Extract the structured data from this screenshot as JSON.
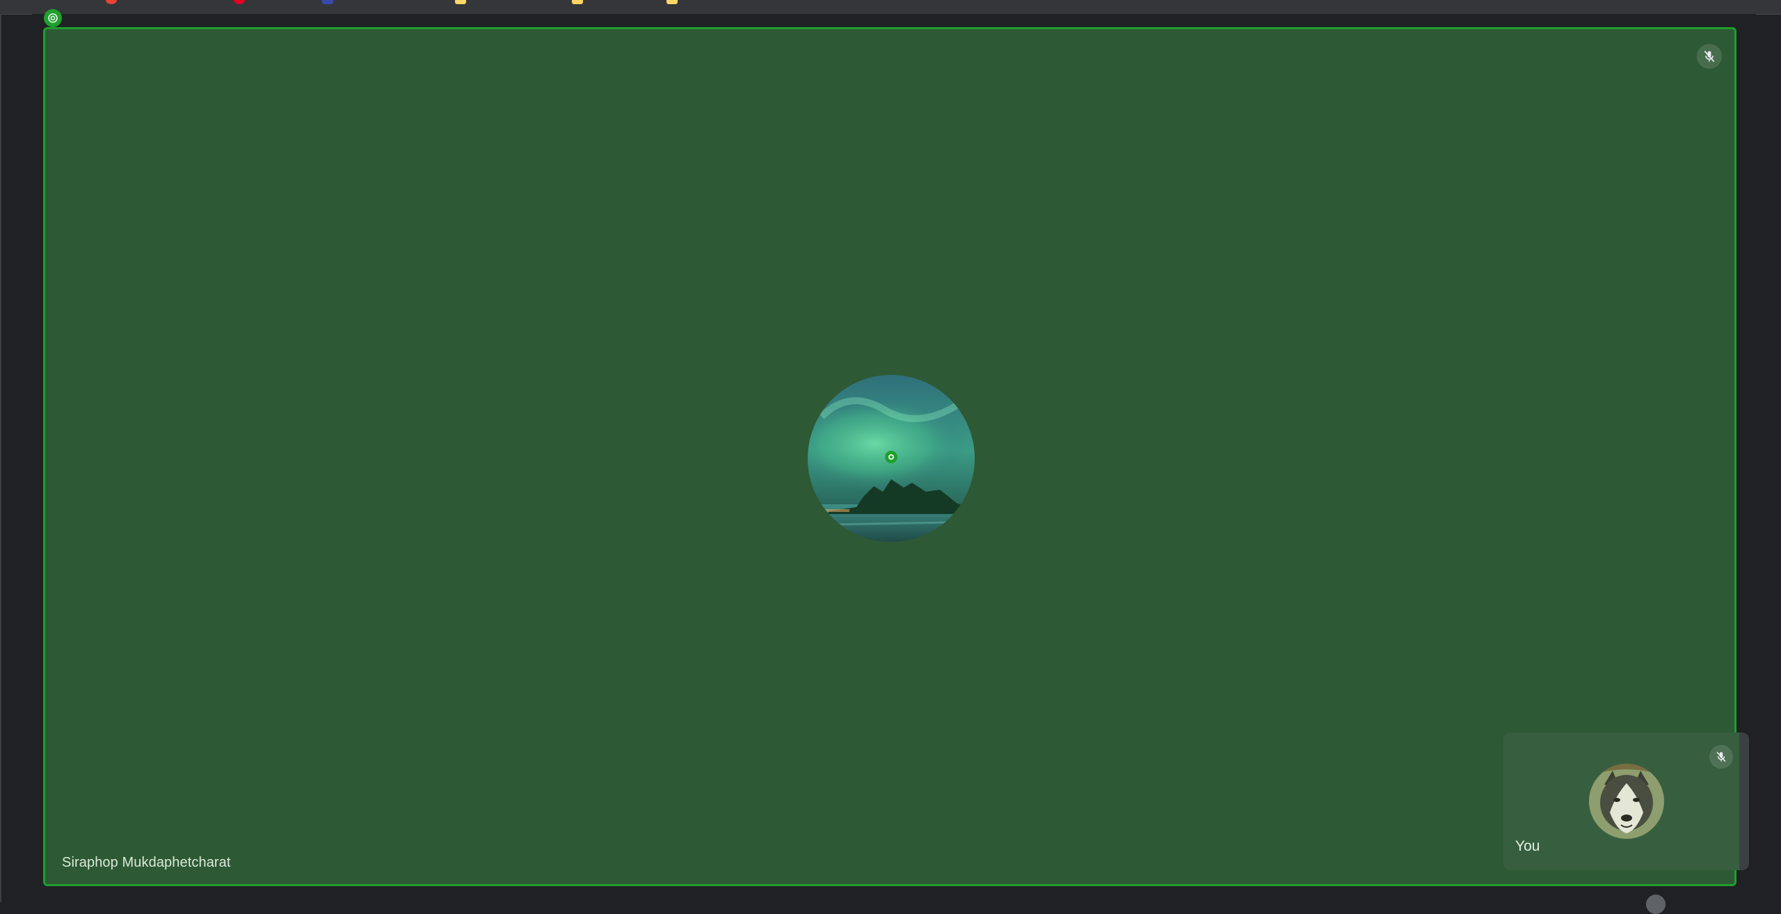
{
  "bookmarks_bar": {
    "icons": [
      {
        "name": "bookmark-red-circle-icon",
        "color": "#ea4335"
      },
      {
        "name": "bookmark-pinterest-icon",
        "color": "#e60023"
      },
      {
        "name": "bookmark-blue-icon",
        "color": "#3949ab"
      },
      {
        "name": "bookmark-folder-icon",
        "color": "#fdd663"
      },
      {
        "name": "bookmark-folder-icon",
        "color": "#fdd663"
      },
      {
        "name": "bookmark-folder-icon",
        "color": "#fdd663"
      }
    ]
  },
  "meeting": {
    "active_speaker": {
      "name": "Siraphop Mukdaphetcharat",
      "muted": true,
      "speaking_highlight_color": "#1e9f2e",
      "avatar": "aurora-landscape-avatar"
    },
    "self_view": {
      "label": "You",
      "muted": true,
      "avatar": "husky-dog-avatar"
    }
  },
  "colors": {
    "tile_background": "#2e5935",
    "self_tile_background": "#375f3f",
    "page_background": "#202124"
  }
}
